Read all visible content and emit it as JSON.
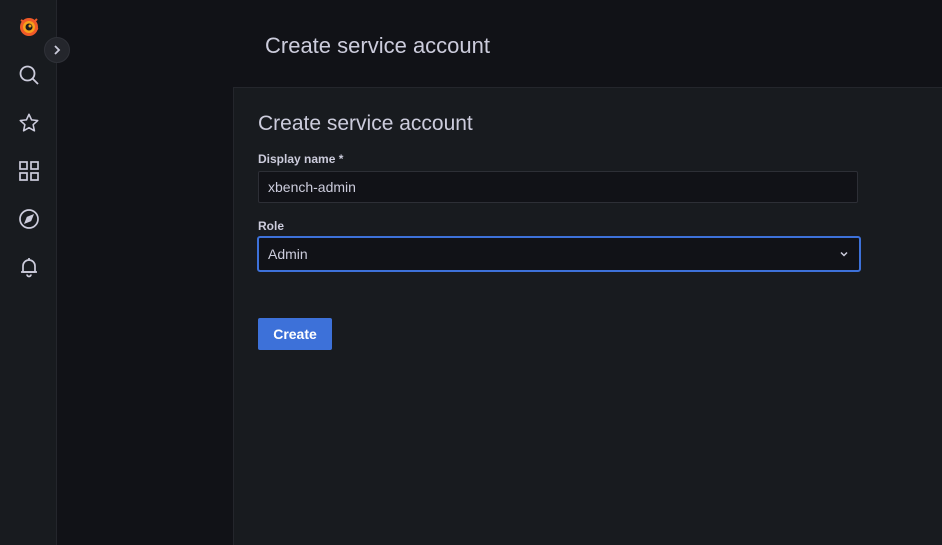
{
  "header": {
    "title": "Create service account"
  },
  "sidebar": {
    "items": [
      {
        "icon": "grafana-logo-icon"
      },
      {
        "icon": "search-icon"
      },
      {
        "icon": "star-icon"
      },
      {
        "icon": "dashboards-icon"
      },
      {
        "icon": "compass-icon"
      },
      {
        "icon": "bell-icon"
      }
    ]
  },
  "form": {
    "title": "Create service account",
    "display_name_label": "Display name *",
    "display_name_value": "xbench-admin",
    "role_label": "Role",
    "role_value": "Admin",
    "submit_label": "Create"
  },
  "colors": {
    "accent": "#3d71d9",
    "background": "#111217",
    "panel": "#181b1f"
  }
}
